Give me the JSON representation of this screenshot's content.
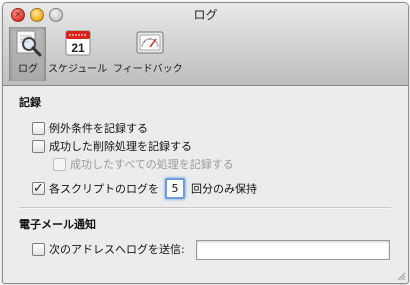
{
  "window": {
    "title": "ログ"
  },
  "toolbar": {
    "items": [
      {
        "label": "ログ",
        "icon": "magnifier-log-icon"
      },
      {
        "label": "スケジュール",
        "icon": "calendar-icon"
      },
      {
        "label": "フィードバック",
        "icon": "gauge-icon"
      }
    ],
    "calendar_day": "21"
  },
  "logging": {
    "section_title": "記録",
    "log_exceptions": {
      "label": "例外条件を記録する",
      "checked": false
    },
    "log_deletions": {
      "label": "成功した削除処理を記録する",
      "checked": false
    },
    "log_all_success": {
      "label": "成功したすべての処理を記録する",
      "checked": false,
      "enabled": false
    },
    "keep_logs": {
      "label": "各スクリプトのログを",
      "checked": true,
      "count": "5",
      "suffix": "回分のみ保持"
    }
  },
  "email": {
    "section_title": "電子メール通知",
    "send_log": {
      "label": "次のアドレスへログを送信:",
      "checked": false,
      "address": ""
    }
  },
  "colors": {
    "focus_ring": "#6e9cd8",
    "selected_tab": "#b0b0b0",
    "window_bg": "#ececec"
  }
}
